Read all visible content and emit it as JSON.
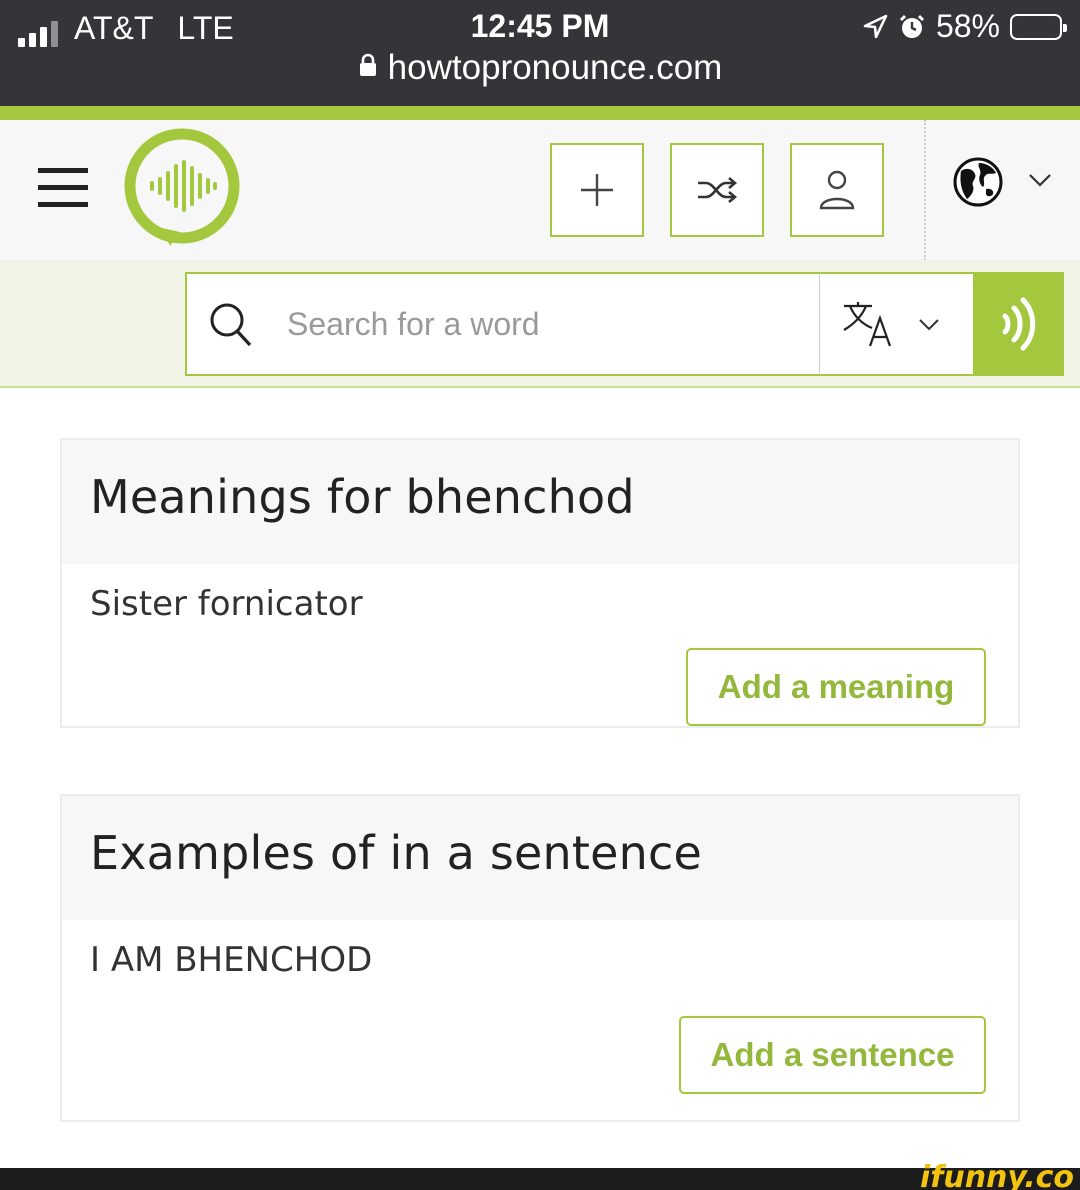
{
  "status_bar": {
    "carrier": "AT&T",
    "network": "LTE",
    "time": "12:45 PM",
    "battery": "58%",
    "battery_level": 0.58,
    "icons": [
      "signal-icon",
      "location-arrow-icon",
      "alarm-icon",
      "battery-icon"
    ]
  },
  "browser": {
    "url": "howtopronounce.com",
    "icons": [
      "lock-icon"
    ]
  },
  "header": {
    "icons": [
      "hamburger-menu-icon",
      "sound-bubble-logo",
      "plus-icon",
      "shuffle-icon",
      "user-icon",
      "globe-icon",
      "chevron-down-icon"
    ]
  },
  "search": {
    "placeholder": "Search for a word",
    "value": "",
    "icons": [
      "search-icon",
      "translate-icon",
      "chevron-down-icon",
      "speaker-waves-icon"
    ]
  },
  "colors": {
    "accent": "#a3c83e",
    "button_text": "#93b83b",
    "status_bar_bg": "#333538",
    "card_header_bg": "#f7f7f7"
  },
  "meanings": {
    "title": "Meanings for bhenchod",
    "text": "Sister fornicator",
    "button": "Add a meaning"
  },
  "examples": {
    "title": "Examples of in a sentence",
    "text": "I AM BHENCHOD",
    "button": "Add a sentence"
  },
  "watermark": "ifunny.co"
}
